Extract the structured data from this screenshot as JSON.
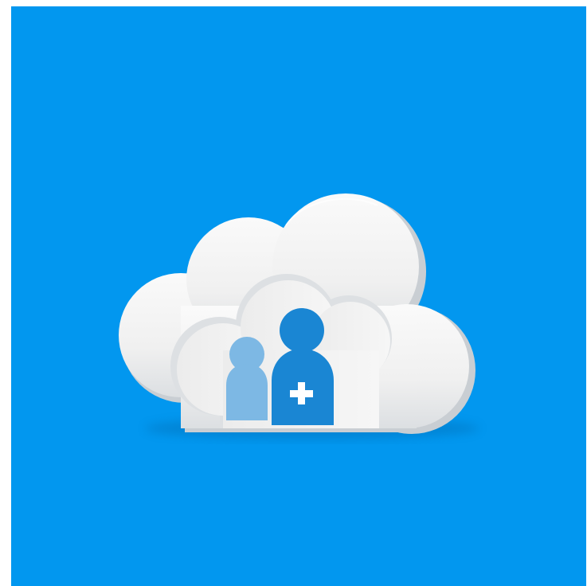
{
  "colors": {
    "page_border": "#ffffff",
    "background": "#0297ef",
    "cloud_white": "#f3f3f3",
    "cloud_shade": "#d9dcdf",
    "person_back": "#7db8e4",
    "person_front": "#1a86d3",
    "plus_symbol": "#ffffff"
  },
  "icons": {
    "main": "cloud-icon",
    "inner": "cloud-outline-icon",
    "user_back": "person-icon",
    "user_front": "person-add-icon",
    "plus": "plus-icon"
  }
}
